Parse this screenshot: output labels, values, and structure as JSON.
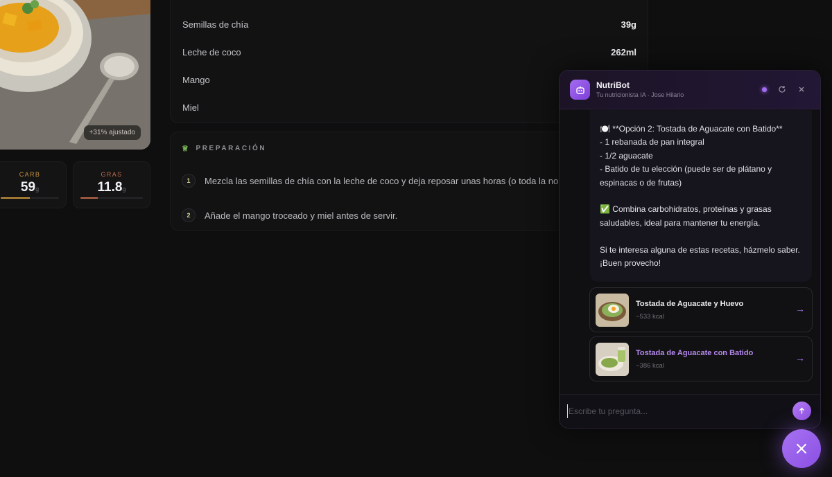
{
  "hero": {
    "badge": "+31% ajustado"
  },
  "macros": [
    {
      "label": "CARB",
      "value": "59",
      "unit": "g",
      "progress": 0.5
    },
    {
      "label": "GRAS",
      "value": "11.8",
      "unit": "g",
      "progress": 0.28
    }
  ],
  "ingredients": [
    {
      "name": "Semillas de chía",
      "qty": "39g"
    },
    {
      "name": "Leche de coco",
      "qty": "262ml"
    },
    {
      "name": "Mango",
      "qty": ""
    },
    {
      "name": "Miel",
      "qty": ""
    }
  ],
  "preparation": {
    "title": "PREPARACIÓN",
    "steps": [
      {
        "num": "1",
        "text": "Mezcla las semillas de chía con la leche de coco y deja reposar unas horas (o toda la no"
      },
      {
        "num": "2",
        "text": "Añade el mango troceado y miel antes de servir."
      }
    ]
  },
  "chat": {
    "bot_name": "NutriBot",
    "bot_subtitle": "Tu nutricionista IA · Jose Hilario",
    "message_lines": [
      "🍽️ **Opción 2: Tostada de Aguacate con Batido**",
      "- 1 rebanada de pan integral",
      "- 1/2 aguacate",
      "- Batido de tu elección (puede ser de plátano y",
      "espinacas o de frutas)",
      "",
      "✅ Combina carbohidratos, proteínas y grasas",
      "saludables, ideal para mantener tu energía.",
      "",
      "Si te interesa alguna de estas recetas, házmelo saber.",
      "¡Buen provecho!"
    ],
    "recipes": [
      {
        "title": "Tostada de Aguacate y Huevo",
        "kcal": "~533 kcal",
        "arrow": "→"
      },
      {
        "title": "Tostada de Aguacate con Batido",
        "kcal": "~386 kcal",
        "arrow": "→"
      }
    ],
    "input": {
      "placeholder": "Escribe tu pregunta...",
      "value": ""
    }
  },
  "colors": {
    "accent": "#a46cf0",
    "carb": "#c8923b",
    "gras": "#c06a4a"
  },
  "icons": [
    "robot-icon",
    "refresh-icon",
    "close-icon",
    "send-arrow-icon",
    "close-fab-icon",
    "chef-hat-icon"
  ]
}
